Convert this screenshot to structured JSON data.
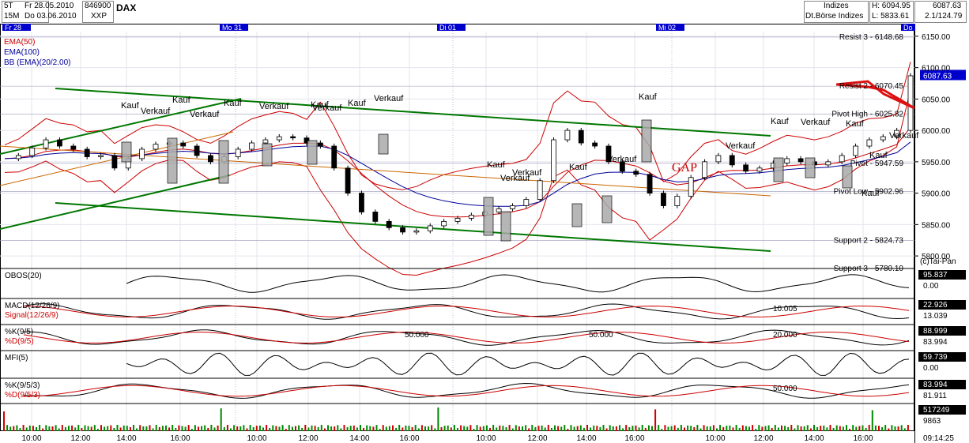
{
  "header": {
    "interval": "5T",
    "interval2": "15M",
    "date_from": "Fr 28.05.2010",
    "date_to": "Do 03.06.2010",
    "id": "846900",
    "exchange": "XXP",
    "symbol": "DAX",
    "category": "Indizes",
    "source": "Dt.Börse Indizes",
    "high": "H: 6094.95",
    "low": "L: 5833.61",
    "last": "6087.63",
    "change": "2.1/124.79"
  },
  "day_labels": [
    "Fr 28",
    "Mo 31",
    "Di 01",
    "Mi 02",
    "Do"
  ],
  "indicator_legend": [
    "EMA(50)",
    "EMA(100)",
    "BB (EMA)(20/2.00)"
  ],
  "levels": [
    "Resist 3 - 6148.68",
    "Resist 2 - 6070.45",
    "Pivot High - 6025.82",
    "Pivot - 5947.59",
    "Pivot Low - 5902.96",
    "Support 2 - 5824.73",
    "Support 3 - 5780.10"
  ],
  "price_axis": [
    "6150.00",
    "6100.00",
    "6050.00",
    "6000.00",
    "5950.00",
    "5900.00",
    "5850.00",
    "5800.00"
  ],
  "price_tag": "6087.63",
  "copyright": "(c)Tai-Pan",
  "gap_label": "GAP",
  "annotations": [
    "Kauf",
    "Verkauf",
    "Kauf",
    "Verkauf",
    "Kauf",
    "Verkauf",
    "Kauf",
    "Verkauf",
    "Kauf",
    "Verkauf",
    "Kauf",
    "Verkauf",
    "Verkauf",
    "Kauf",
    "Verkauf",
    "Kauf",
    "Verkauf",
    "Kauf",
    "Verkauf",
    "Kauf",
    "Kauf",
    "Verkauf",
    "Kauf"
  ],
  "panels": [
    {
      "name": "OBOS(20)",
      "value": "95.837",
      "value2": "0.00",
      "labels": []
    },
    {
      "name": "MACD(12/26/9)",
      "name2": "Signal(12/26/9)",
      "value": "22.926",
      "value2": "13.039",
      "labels": [
        "10.005"
      ]
    },
    {
      "name": "%K(9/5)",
      "name2": "%D(9/5)",
      "value": "88.999",
      "value2": "83.994",
      "labels": [
        "50.000",
        "50.000",
        "20.000"
      ]
    },
    {
      "name": "MFI(5)",
      "value": "59.739",
      "value2": "0.00",
      "labels": []
    },
    {
      "name": "%K(9/5/3)",
      "name2": "%D(9/5/3)",
      "value": "83.994",
      "value2": "81.911",
      "labels": [
        "50.000"
      ]
    },
    {
      "name": "",
      "value": "517249",
      "value2": "9863",
      "labels": []
    }
  ],
  "time_axis": [
    "10:00",
    "12:00",
    "14:00",
    "16:00",
    "10:00",
    "12:00",
    "14:00",
    "16:00",
    "10:00",
    "12:00",
    "14:00",
    "16:00",
    "10:00",
    "12:00",
    "14:00",
    "16:00"
  ],
  "clock": "09:14:25",
  "colors": {
    "ema50": "#cc0000",
    "ema100": "#000099",
    "bb": "#cc0000",
    "trend": "#007700",
    "channel": "#cc6600",
    "day_marker": "#0000cc",
    "price_tag": "#0000cc"
  },
  "chart_data": {
    "type": "candlestick",
    "title": "DAX",
    "ylim": [
      5780,
      6170
    ],
    "series": [
      {
        "name": "EMA(50)"
      },
      {
        "name": "EMA(100)"
      },
      {
        "name": "BB (EMA)(20/2.00)"
      }
    ],
    "levels": [
      {
        "label": "Resist 3",
        "value": 6148.68
      },
      {
        "label": "Resist 2",
        "value": 6070.45
      },
      {
        "label": "Pivot High",
        "value": 6025.82
      },
      {
        "label": "Pivot",
        "value": 5947.59
      },
      {
        "label": "Pivot Low",
        "value": 5902.96
      },
      {
        "label": "Support 2",
        "value": 5824.73
      },
      {
        "label": "Support 3",
        "value": 5780.1
      }
    ],
    "last": 6087.63,
    "high": 6094.95,
    "low": 5833.61,
    "close_path": [
      5955,
      5960,
      5972,
      5985,
      5975,
      5970,
      5958,
      5960,
      5940,
      5955,
      5970,
      5978,
      5980,
      5975,
      5960,
      5950,
      5958,
      5970,
      5980,
      5985,
      5990,
      5988,
      5980,
      5975,
      5940,
      5900,
      5870,
      5855,
      5845,
      5838,
      5840,
      5848,
      5855,
      5860,
      5865,
      5870,
      5875,
      5880,
      5890,
      5920,
      5985,
      6000,
      5980,
      5975,
      5950,
      5935,
      5930,
      5900,
      5880,
      5895,
      5925,
      5950,
      5960,
      5945,
      5935,
      5940,
      5948,
      5955,
      5950,
      5945,
      5950,
      5960,
      5975,
      5985,
      5990,
      6000,
      6087
    ]
  }
}
